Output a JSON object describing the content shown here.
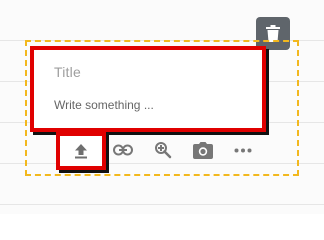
{
  "editor": {
    "title_placeholder": "Title",
    "body_placeholder": "Write something ..."
  },
  "icons": {
    "delete": "trash-icon",
    "upload": "upload-icon",
    "link": "link-icon",
    "search": "search-icon",
    "camera": "camera-icon",
    "more": "more-icon"
  },
  "colors": {
    "highlight": "#e00000",
    "dashed_frame": "#f2b81e",
    "trash_button": "#5f656b",
    "icon": "#777777"
  }
}
